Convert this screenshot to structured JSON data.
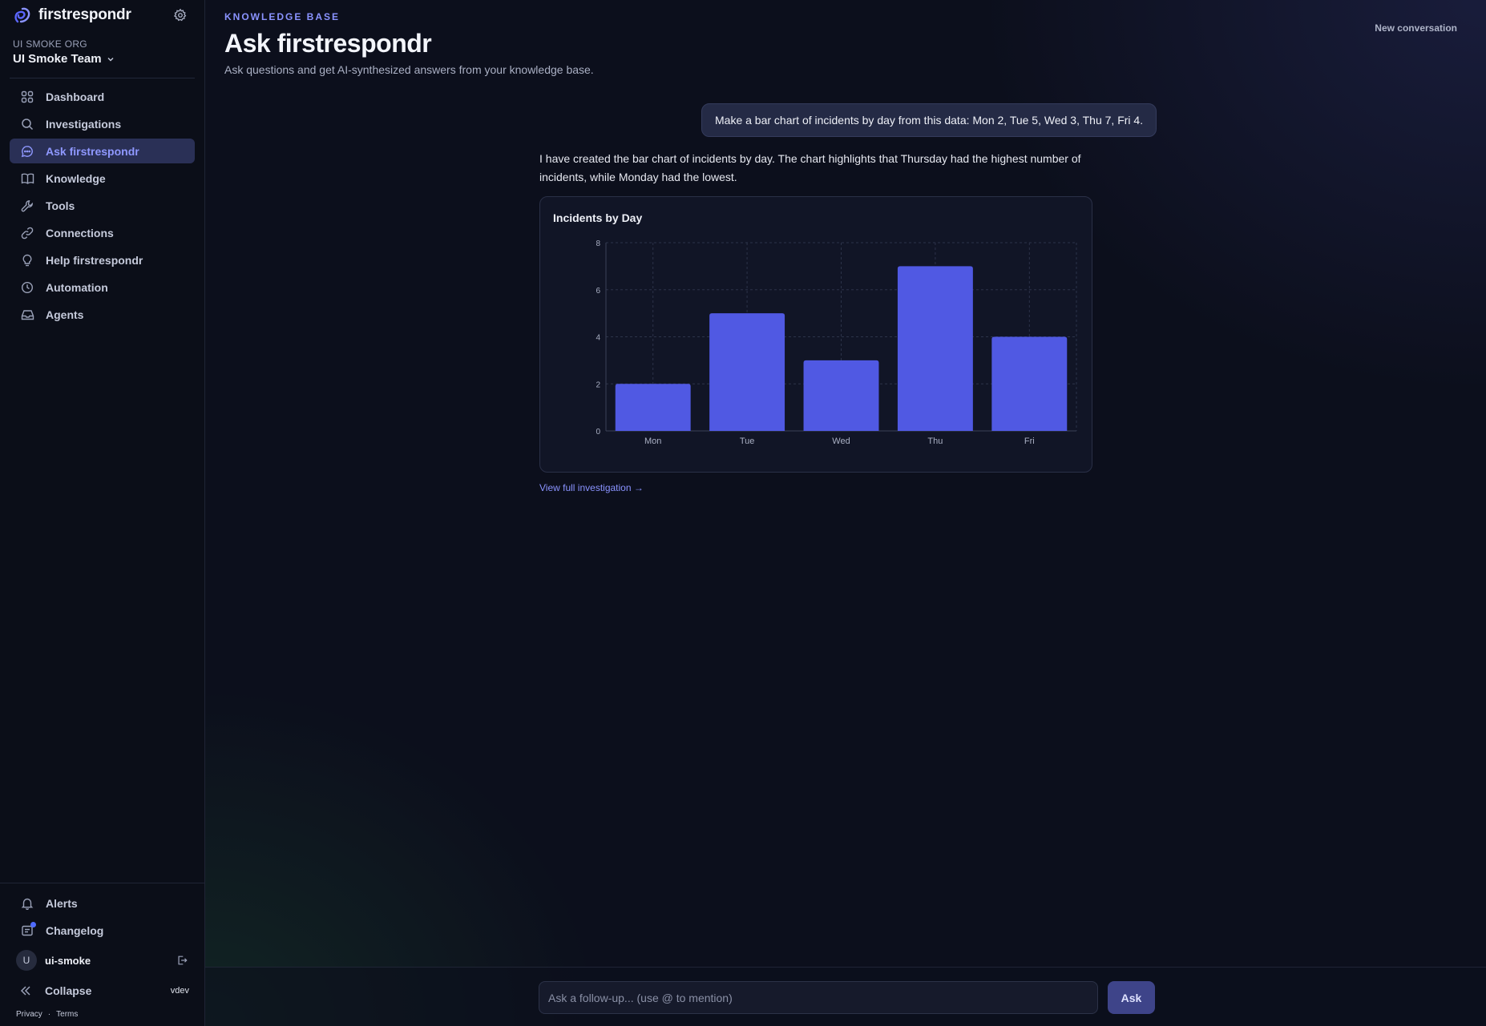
{
  "app": {
    "name": "firstrespondr"
  },
  "org": {
    "label": "UI SMOKE ORG",
    "team": "UI Smoke Team"
  },
  "sidebar": {
    "items": [
      {
        "label": "Dashboard",
        "icon": "grid-icon",
        "active": false
      },
      {
        "label": "Investigations",
        "icon": "search-icon",
        "active": false
      },
      {
        "label": "Ask firstrespondr",
        "icon": "chat-bubble-icon",
        "active": true
      },
      {
        "label": "Knowledge",
        "icon": "book-icon",
        "active": false
      },
      {
        "label": "Tools",
        "icon": "wrench-icon",
        "active": false
      },
      {
        "label": "Connections",
        "icon": "link-icon",
        "active": false
      },
      {
        "label": "Help firstrespondr",
        "icon": "lightbulb-icon",
        "active": false
      },
      {
        "label": "Automation",
        "icon": "clock-icon",
        "active": false
      },
      {
        "label": "Agents",
        "icon": "inbox-icon",
        "active": false
      }
    ],
    "bottom": [
      {
        "label": "Alerts",
        "icon": "bell-icon"
      },
      {
        "label": "Changelog",
        "icon": "changelog-icon"
      }
    ],
    "user": {
      "initial": "U",
      "name": "ui-smoke"
    },
    "collapse_label": "Collapse",
    "version": "vdev",
    "footer": {
      "privacy": "Privacy",
      "separator": "·",
      "terms": "Terms"
    }
  },
  "header": {
    "eyebrow": "KNOWLEDGE BASE",
    "title": "Ask firstrespondr",
    "subtitle": "Ask questions and get AI-synthesized answers from your knowledge base.",
    "new_conversation": "New conversation"
  },
  "conversation": {
    "user_message": "Make a bar chart of incidents by day from this data: Mon 2, Tue 5, Wed 3, Thu 7, Fri 4.",
    "answer": "I have created the bar chart of incidents by day. The chart highlights that Thursday had the highest number of incidents, while Monday had the lowest.",
    "view_link": "View full investigation →"
  },
  "chart_data": {
    "type": "bar",
    "title": "Incidents by Day",
    "categories": [
      "Mon",
      "Tue",
      "Wed",
      "Thu",
      "Fri"
    ],
    "values": [
      2,
      5,
      3,
      7,
      4
    ],
    "xlabel": "",
    "ylabel": "",
    "ylim": [
      0,
      8
    ],
    "yticks": [
      0,
      2,
      4,
      6,
      8
    ],
    "grid": true,
    "bar_color": "#5059e3"
  },
  "composer": {
    "placeholder": "Ask a follow-up... (use @ to mention)",
    "ask_label": "Ask"
  },
  "colors": {
    "accent": "#8a93ff",
    "active_nav_bg": "#2a3056",
    "bar": "#5059e3"
  }
}
